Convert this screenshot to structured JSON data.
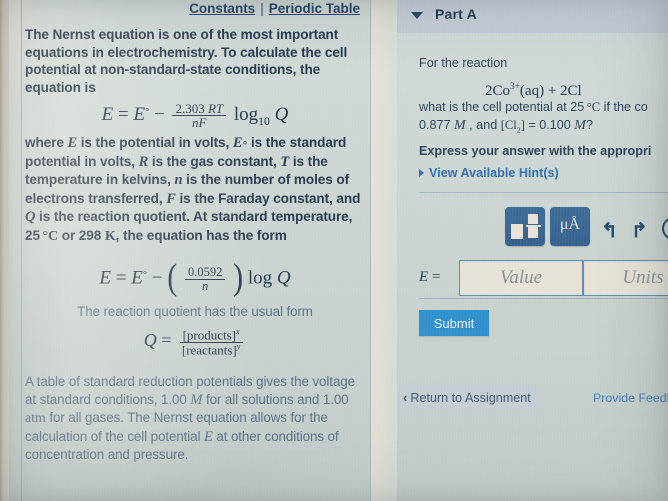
{
  "app": {
    "kind": "online-chemistry-homework",
    "accent_blue": "#2f8fcd",
    "link_blue": "#2f6fb0",
    "text_navy": "#27384f",
    "panel_bg": "#ccd6d2"
  },
  "left_panel": {
    "toplinks": {
      "constants": "Constants",
      "separator": "|",
      "periodic_table": "Periodic Table"
    },
    "intro_paragraph": "The Nernst equation is one of the most important equations in electrochemistry. To calculate the cell potential at non-standard-state conditions, the equation is",
    "equation_1": {
      "lhs": "E = E° −",
      "fraction_numerator": "2.303 RT",
      "fraction_denominator": "nF",
      "log": "log",
      "log_base": "10",
      "operand": "Q",
      "plain": "E = E° − (2.303 RT / nF) log10 Q"
    },
    "where_paragraph_parts": [
      "where ",
      "E",
      " is the potential in volts, ",
      "E°",
      " is the standard potential in volts, ",
      "R",
      " is the gas constant, ",
      "T",
      " is the temperature in kelvins, ",
      "n",
      " is the number of moles of electrons transferred, ",
      "F",
      " is the Faraday constant, and ",
      "Q",
      " is the reaction quotient. At standard temperature, 25 °C or 298 K, the equation has the form"
    ],
    "where_paragraph_plain": "where E is the potential in volts, E° is the standard potential in volts, R is the gas constant, T is the temperature in kelvins, n is the number of moles of electrons transferred, F is the Faraday constant, and Q is the reaction quotient. At standard temperature, 25 °C or 298 K, the equation has the form",
    "equation_2": {
      "lhs": "E = E° −",
      "fraction_numerator": "0.0592",
      "fraction_denominator": "n",
      "log": "log",
      "operand": "Q",
      "plain": "E = E° − (0.0592 / n) log Q"
    },
    "quotient_intro": "The reaction quotient has the usual form",
    "equation_3": {
      "lhs": "Q =",
      "fraction_numerator": "[products]",
      "numerator_exponent": "x",
      "fraction_denominator": "[reactants]",
      "denominator_exponent": "y",
      "plain": "Q = [products]^x / [reactants]^y"
    },
    "closing_paragraph_plain": "A table of standard reduction potentials gives the voltage at standard conditions, 1.00 M for all solutions and 1.00 atm for all gases. The Nernst equation allows for the calculation of the cell potential E at other conditions of concentration and pressure."
  },
  "right_panel": {
    "part_header": {
      "title": "Part A",
      "caret_icon": "chevron-down-icon"
    },
    "prompt_intro": "For the reaction",
    "reaction": "2Co³⁺(aq) + 2Cl",
    "reaction_truncated": true,
    "question_line_1": "what is the cell potential at 25 °C if the co",
    "question_line_2": "0.877 M, and [Cl₂] = 0.100 M?",
    "instruction": "Express your answer with the appropri",
    "hints_link": "View Available Hint(s)",
    "toolbar": {
      "template_button": "template-icon",
      "units_button": "μÅ",
      "undo_button": "undo-icon",
      "redo_button": "redo-icon",
      "reset_button": "reset-icon"
    },
    "answer": {
      "label": "E =",
      "value_placeholder": "Value",
      "units_placeholder": "Units",
      "value": "",
      "units": ""
    },
    "submit_label": "Submit",
    "return_link": "Return to Assignment",
    "return_chevron": "‹",
    "feedback_link": "Provide Feedb"
  }
}
